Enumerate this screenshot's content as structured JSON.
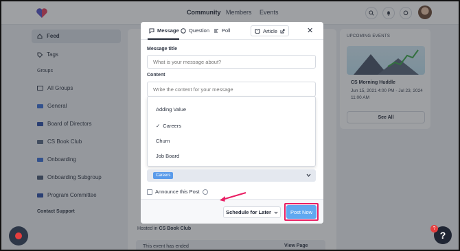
{
  "topbar": {
    "nav": [
      "Community",
      "Members",
      "Events"
    ]
  },
  "sidebar": {
    "feed": "Feed",
    "tags": "Tags",
    "groups_heading": "Groups",
    "items": [
      "All Groups",
      "General",
      "Board of Directors",
      "CS Book Club",
      "Onboarding",
      "Onboarding Subgroup",
      "Program Committee"
    ],
    "support": "Contact Support"
  },
  "background": {
    "hosted_prefix": "Hosted in",
    "hosted_group": "CS Book Club",
    "ended": "This event has ended",
    "view_page": "View Page"
  },
  "right_panel": {
    "title": "UPCOMING EVENTS",
    "event_name": "CS Morning Huddle",
    "event_date": "Jun 15, 2021 4:00 PM - Jul 23, 2024 11:00 AM",
    "see_all": "See All"
  },
  "modal": {
    "tabs": [
      "Message",
      "Question",
      "Poll"
    ],
    "article": "Article",
    "title_label": "Message title",
    "title_placeholder": "What is your message about?",
    "content_label": "Content",
    "content_placeholder": "Write the content for your message",
    "dropdown_items": [
      "Adding Value",
      "Careers",
      "Churn",
      "Job Board"
    ],
    "selected_tag": "Careers",
    "announce": "Announce this Post",
    "schedule": "Schedule for Later",
    "post": "Post Now"
  },
  "colors": {
    "accent": "#60a8f0",
    "highlight": "#e91e63",
    "tag": "#5a9bea"
  }
}
